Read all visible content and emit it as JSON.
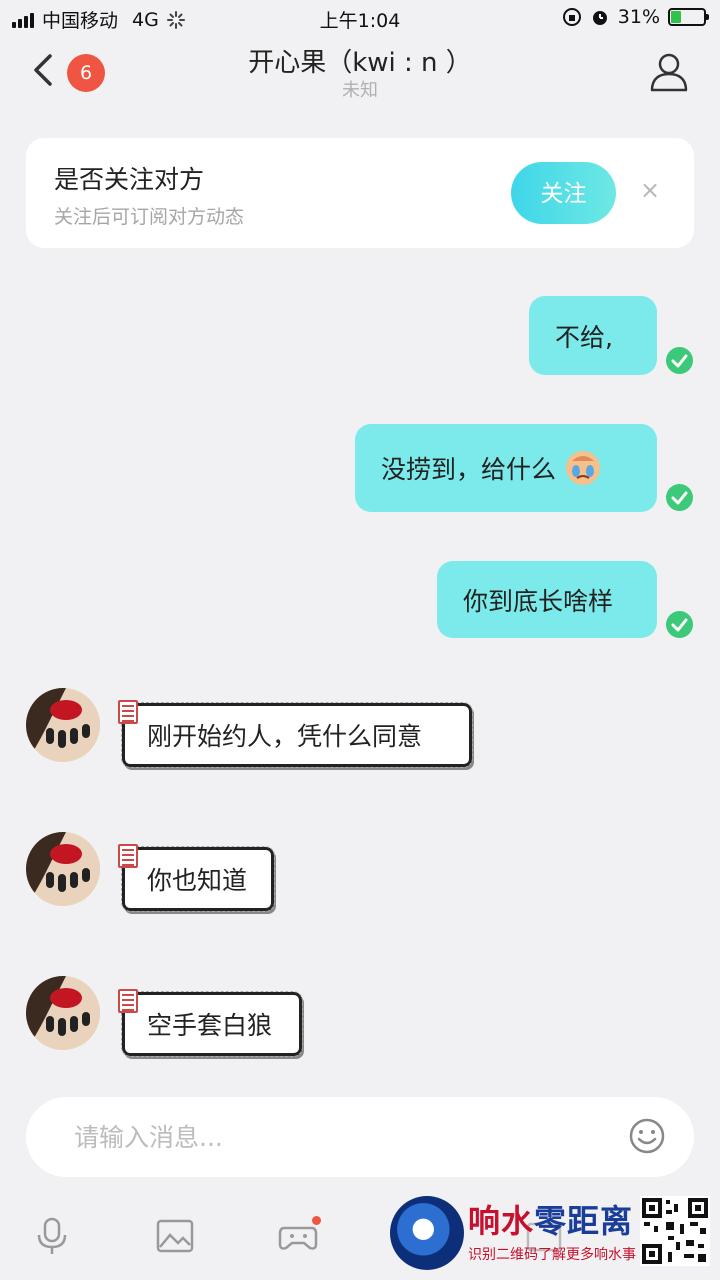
{
  "status_bar": {
    "carrier": "中国移动",
    "network": "4G",
    "time": "上午1:04",
    "battery": "31%",
    "battery_level": 0.31
  },
  "header": {
    "unread_count": "6",
    "title": "开心果（kwi : n ）",
    "subtitle": "未知",
    "icons": [
      "back-icon",
      "user-profile-icon"
    ]
  },
  "follow_card": {
    "title": "是否关注对方",
    "subtitle": "关注后可订阅对方动态",
    "button_label": "关注",
    "close_label": "×"
  },
  "messages_out": [
    {
      "text": "不给,",
      "status": "read"
    },
    {
      "text": "没捞到，给什么",
      "emoji": "crying-face-emoji",
      "status": "read"
    },
    {
      "text": "你到底长啥样",
      "status": "read"
    }
  ],
  "messages_in": [
    {
      "text": "刚开始约人，凭什么同意"
    },
    {
      "text": "你也知道"
    },
    {
      "text": "空手套白狼"
    }
  ],
  "input": {
    "placeholder": "请输入消息..."
  },
  "toolbar": {
    "items": [
      "microphone-icon",
      "image-icon",
      "game-controller-icon",
      "gif-icon"
    ]
  },
  "watermark": {
    "title_red": "响水",
    "title_blue": "零距离",
    "subtitle": "识别二维码了解更多响水事"
  },
  "colors": {
    "accent": "#7ceaea",
    "badge": "#f05443",
    "check": "#3dc97a",
    "background": "#f1f1f3"
  }
}
